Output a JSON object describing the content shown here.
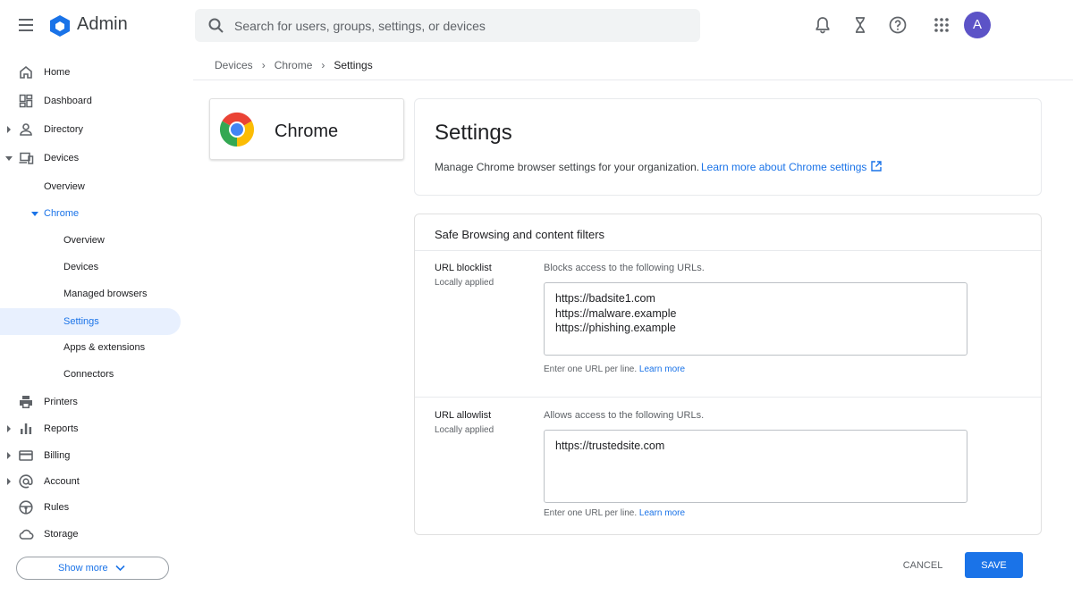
{
  "app": {
    "title": "Admin"
  },
  "search": {
    "placeholder": "Search for users, groups, settings, or devices"
  },
  "topbar": {
    "icons": [
      "notifications-icon",
      "hourglass-icon",
      "help-icon",
      "apps-grid-icon"
    ],
    "avatar_initial": "A",
    "avatar_color": "#5c53c7"
  },
  "sidebar": {
    "items": [
      {
        "label": "Home",
        "icon": "home-icon",
        "level": 0,
        "expandable": false
      },
      {
        "label": "Dashboard",
        "icon": "dashboard-icon",
        "level": 0,
        "expandable": false
      },
      {
        "label": "Directory",
        "icon": "person-icon",
        "level": 0,
        "expandable": true,
        "expanded": false
      },
      {
        "label": "Devices",
        "icon": "devices-icon",
        "level": 0,
        "expandable": true,
        "expanded": true
      },
      {
        "label": "Overview",
        "level": 1
      },
      {
        "label": "Chrome",
        "level": 1,
        "expandable": true,
        "expanded": true
      },
      {
        "label": "Overview",
        "level": 2
      },
      {
        "label": "Devices",
        "level": 2
      },
      {
        "label": "Managed browsers",
        "level": 2
      },
      {
        "label": "Settings",
        "level": 2,
        "active": true
      },
      {
        "label": "Apps & extensions",
        "level": 2
      },
      {
        "label": "Connectors",
        "level": 2
      },
      {
        "label": "Printers",
        "icon": "printer-icon",
        "level": 0
      },
      {
        "label": "Reports",
        "icon": "bar-chart-icon",
        "level": 0,
        "expandable": true
      },
      {
        "label": "Billing",
        "icon": "credit-card-icon",
        "level": 0,
        "expandable": true
      },
      {
        "label": "Account",
        "icon": "at-sign-icon",
        "level": 0,
        "expandable": true
      },
      {
        "label": "Rules",
        "icon": "steering-wheel-icon",
        "level": 0
      },
      {
        "label": "Storage",
        "icon": "cloud-icon",
        "level": 0
      }
    ],
    "show_more_label": "Show more"
  },
  "breadcrumb": {
    "items": [
      "Devices",
      "Chrome",
      "Settings"
    ]
  },
  "chrome_card": {
    "title": "Chrome"
  },
  "settings": {
    "title": "Settings",
    "description": "Manage Chrome browser settings for your organization.",
    "learn_more_link": "Learn more about Chrome settings"
  },
  "safe_browsing": {
    "title": "Safe Browsing and content filters",
    "blocklist": {
      "label": "URL blocklist",
      "status": "Locally applied",
      "description": "Blocks access to the following URLs.",
      "value": "https://badsite1.com\nhttps://malware.example\nhttps://phishing.example",
      "hint": "Enter one URL per line.",
      "hint_link": "Learn more"
    },
    "allowlist": {
      "label": "URL allowlist",
      "status": "Locally applied",
      "description": "Allows access to the following URLs.",
      "value": "https://trustedsite.com",
      "hint": "Enter one URL per line.",
      "hint_link": "Learn more"
    }
  },
  "actions": {
    "cancel_label": "CANCEL",
    "save_label": "SAVE"
  },
  "colors": {
    "accent": "#1a73e8",
    "active_bg": "#e8f0fe"
  }
}
